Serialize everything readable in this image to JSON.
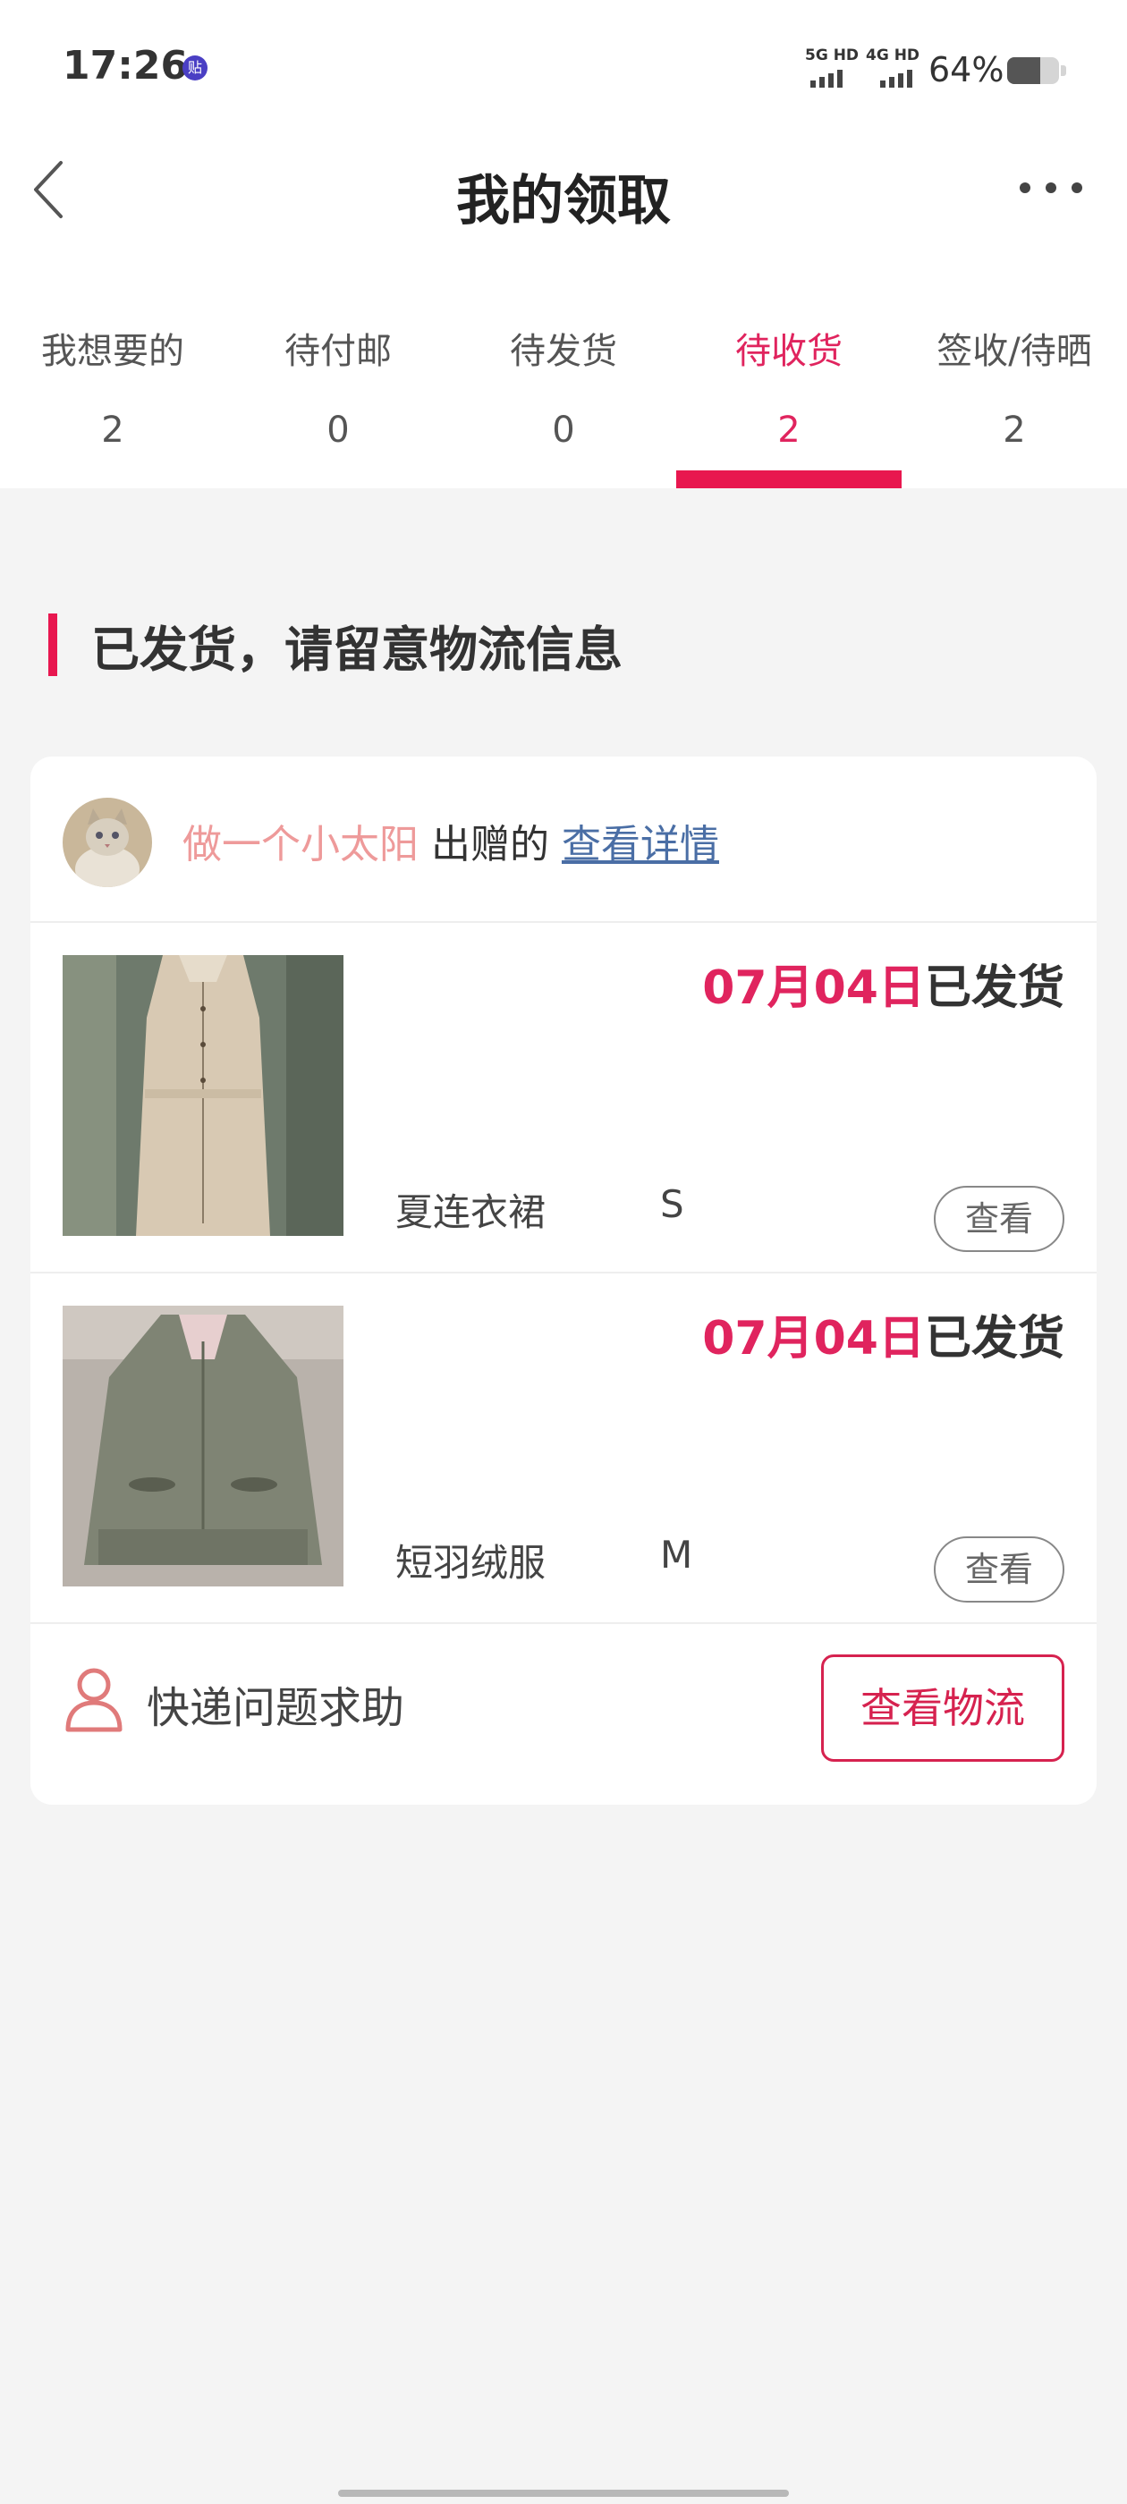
{
  "status_bar": {
    "time": "17:26",
    "notif_badge": "贴",
    "sim1_label": "5G HD",
    "sim2_label": "4G HD",
    "battery_text": "64%",
    "battery_level": 0.64
  },
  "nav": {
    "title": "我的领取"
  },
  "tabs": [
    {
      "label": "我想要的",
      "count": "2"
    },
    {
      "label": "待付邮",
      "count": "0"
    },
    {
      "label": "待发货",
      "count": "0"
    },
    {
      "label": "待收货",
      "count": "2",
      "active": true
    },
    {
      "label": "签收/待晒",
      "count": "2"
    }
  ],
  "section": {
    "title": "已发货，请留意物流信息"
  },
  "order": {
    "giver_name": "做一个小太阳",
    "giver_suffix": " 出赠的 ",
    "detail_link": "查看详情",
    "items": [
      {
        "date": "07月04日",
        "status": "已发货",
        "name": "夏连衣裙",
        "size": "S",
        "view_label": "查看"
      },
      {
        "date": "07月04日",
        "status": "已发货",
        "name": "短羽绒服",
        "size": "M",
        "view_label": "查看"
      }
    ],
    "help_label": "快递问题求助",
    "logistics_label": "查看物流"
  },
  "colors": {
    "accent": "#e8174f",
    "giver_name": "#ee9a9a",
    "link": "#4a6ea5"
  }
}
